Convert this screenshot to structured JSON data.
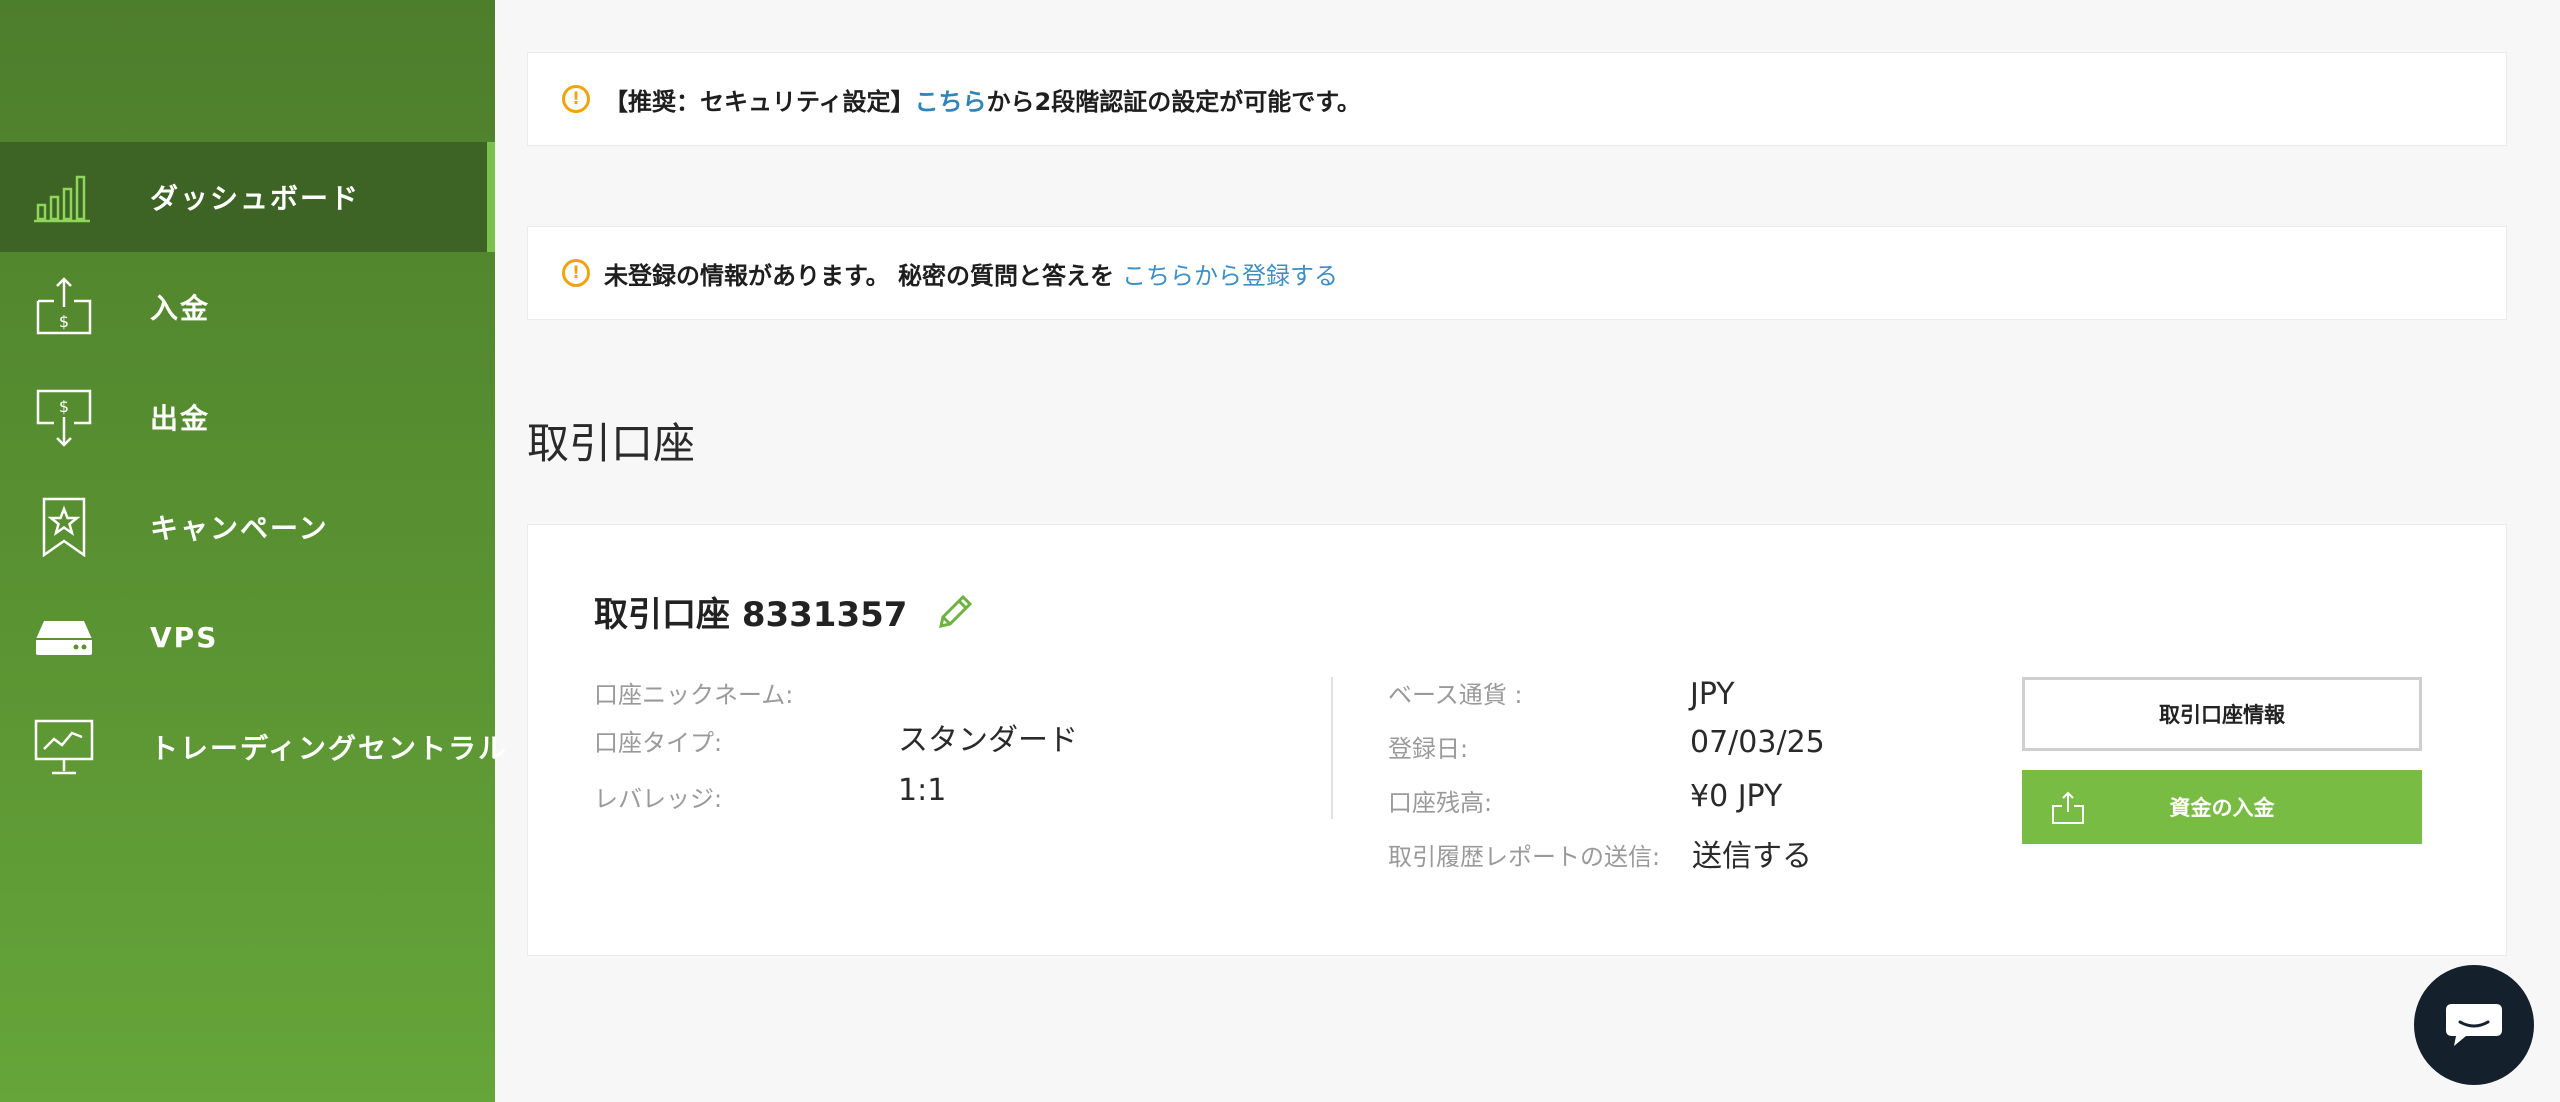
{
  "sidebar": {
    "items": [
      {
        "label": "ダッシュボード",
        "icon": "bar-chart-icon",
        "active": true
      },
      {
        "label": "入金",
        "icon": "deposit-icon"
      },
      {
        "label": "出金",
        "icon": "withdraw-icon"
      },
      {
        "label": "キャンペーン",
        "icon": "bookmark-star-icon"
      },
      {
        "label": "VPS",
        "icon": "server-icon"
      },
      {
        "label": "トレーディングセントラル",
        "icon": "monitor-chart-icon"
      }
    ]
  },
  "notices": {
    "security": {
      "prefix": "【推奨：セキュリティ設定】",
      "link": "こちら",
      "suffix": "から2段階認証の設定が可能です。"
    },
    "secret": {
      "text": "未登録の情報があります。 秘密の質問と答えを",
      "link": "こちらから登録する"
    }
  },
  "main": {
    "section_title": "取引口座"
  },
  "account": {
    "title": "取引口座 8331357",
    "left_fields": [
      {
        "label": "口座ニックネーム:",
        "value": ""
      },
      {
        "label": "口座タイプ:",
        "value": "スタンダード"
      },
      {
        "label": "レバレッジ:",
        "value": "1:1"
      }
    ],
    "right_fields": [
      {
        "label": "ベース通貨 :",
        "value": "JPY"
      },
      {
        "label": "登録日:",
        "value": "07/03/25"
      },
      {
        "label": "口座残高:",
        "value": "¥0 JPY"
      },
      {
        "label": "取引履歴レポートの送信:",
        "value": "送信する"
      }
    ],
    "info_button": "取引口座情報",
    "deposit_button": "資金の入金"
  },
  "colors": {
    "accent": "#78bc44",
    "sidebar_active": "#3d6424",
    "link": "#2f84b8",
    "warning": "#f0a30a",
    "chat": "#14202c"
  }
}
